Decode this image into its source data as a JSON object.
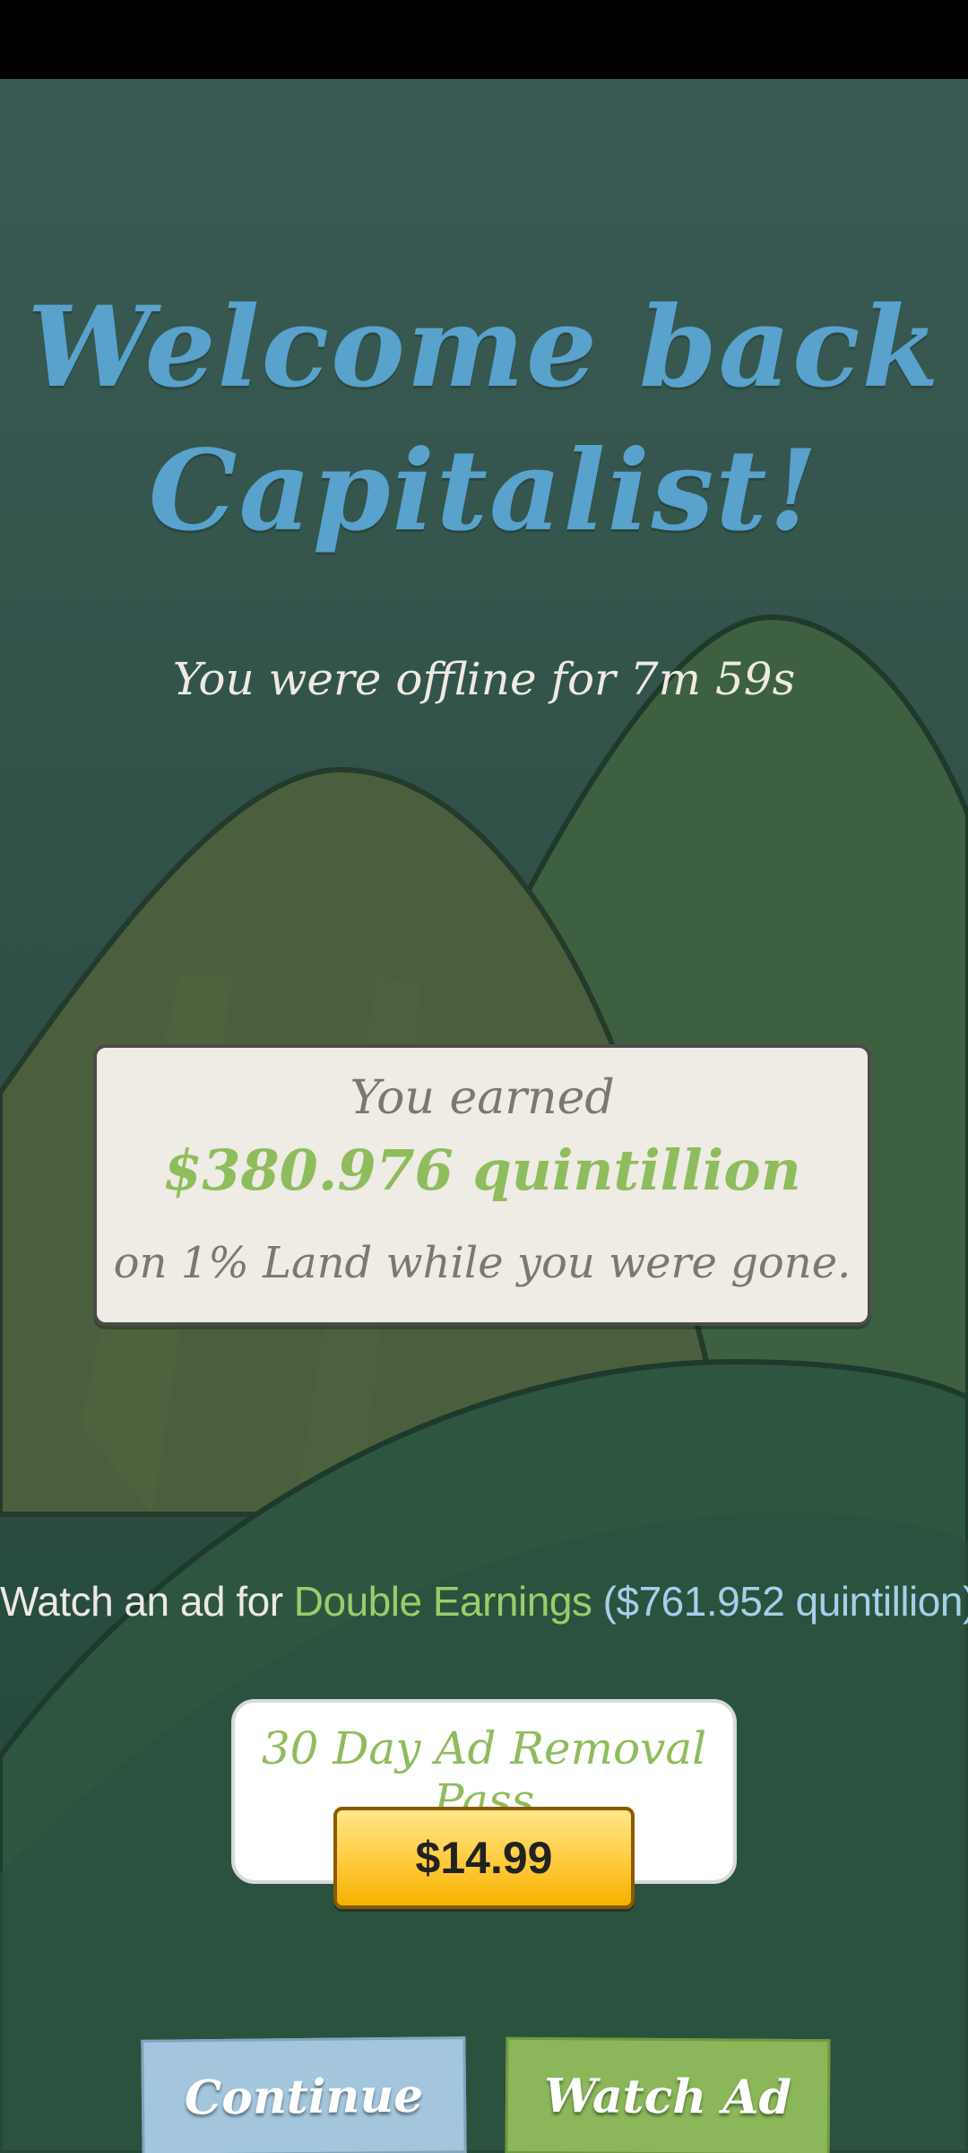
{
  "colors": {
    "title_blue": "#58a2cc",
    "money_green": "#8fbc5c",
    "highlight_blue": "#a4d0ea",
    "price_gold": "#ffcb3b",
    "continue_blue": "#a3c6dd",
    "watch_green": "#8bb75a"
  },
  "welcome": {
    "title_line1": "Welcome back",
    "title_line2": "Capitalist!",
    "offline_text": "You were offline for 7m 59s"
  },
  "earnings": {
    "label": "You earned",
    "amount": "$380.976 quintillion",
    "subtext": "on 1% Land while you were gone."
  },
  "ad_offer": {
    "prefix": "Watch an ad for ",
    "highlight": "Double Earnings",
    "amount": " ($761.952 quintillion)"
  },
  "pass": {
    "title": "30 Day Ad Removal Pass",
    "price": "$14.99"
  },
  "actions": {
    "continue_label": "Continue",
    "watch_label": "Watch Ad"
  }
}
